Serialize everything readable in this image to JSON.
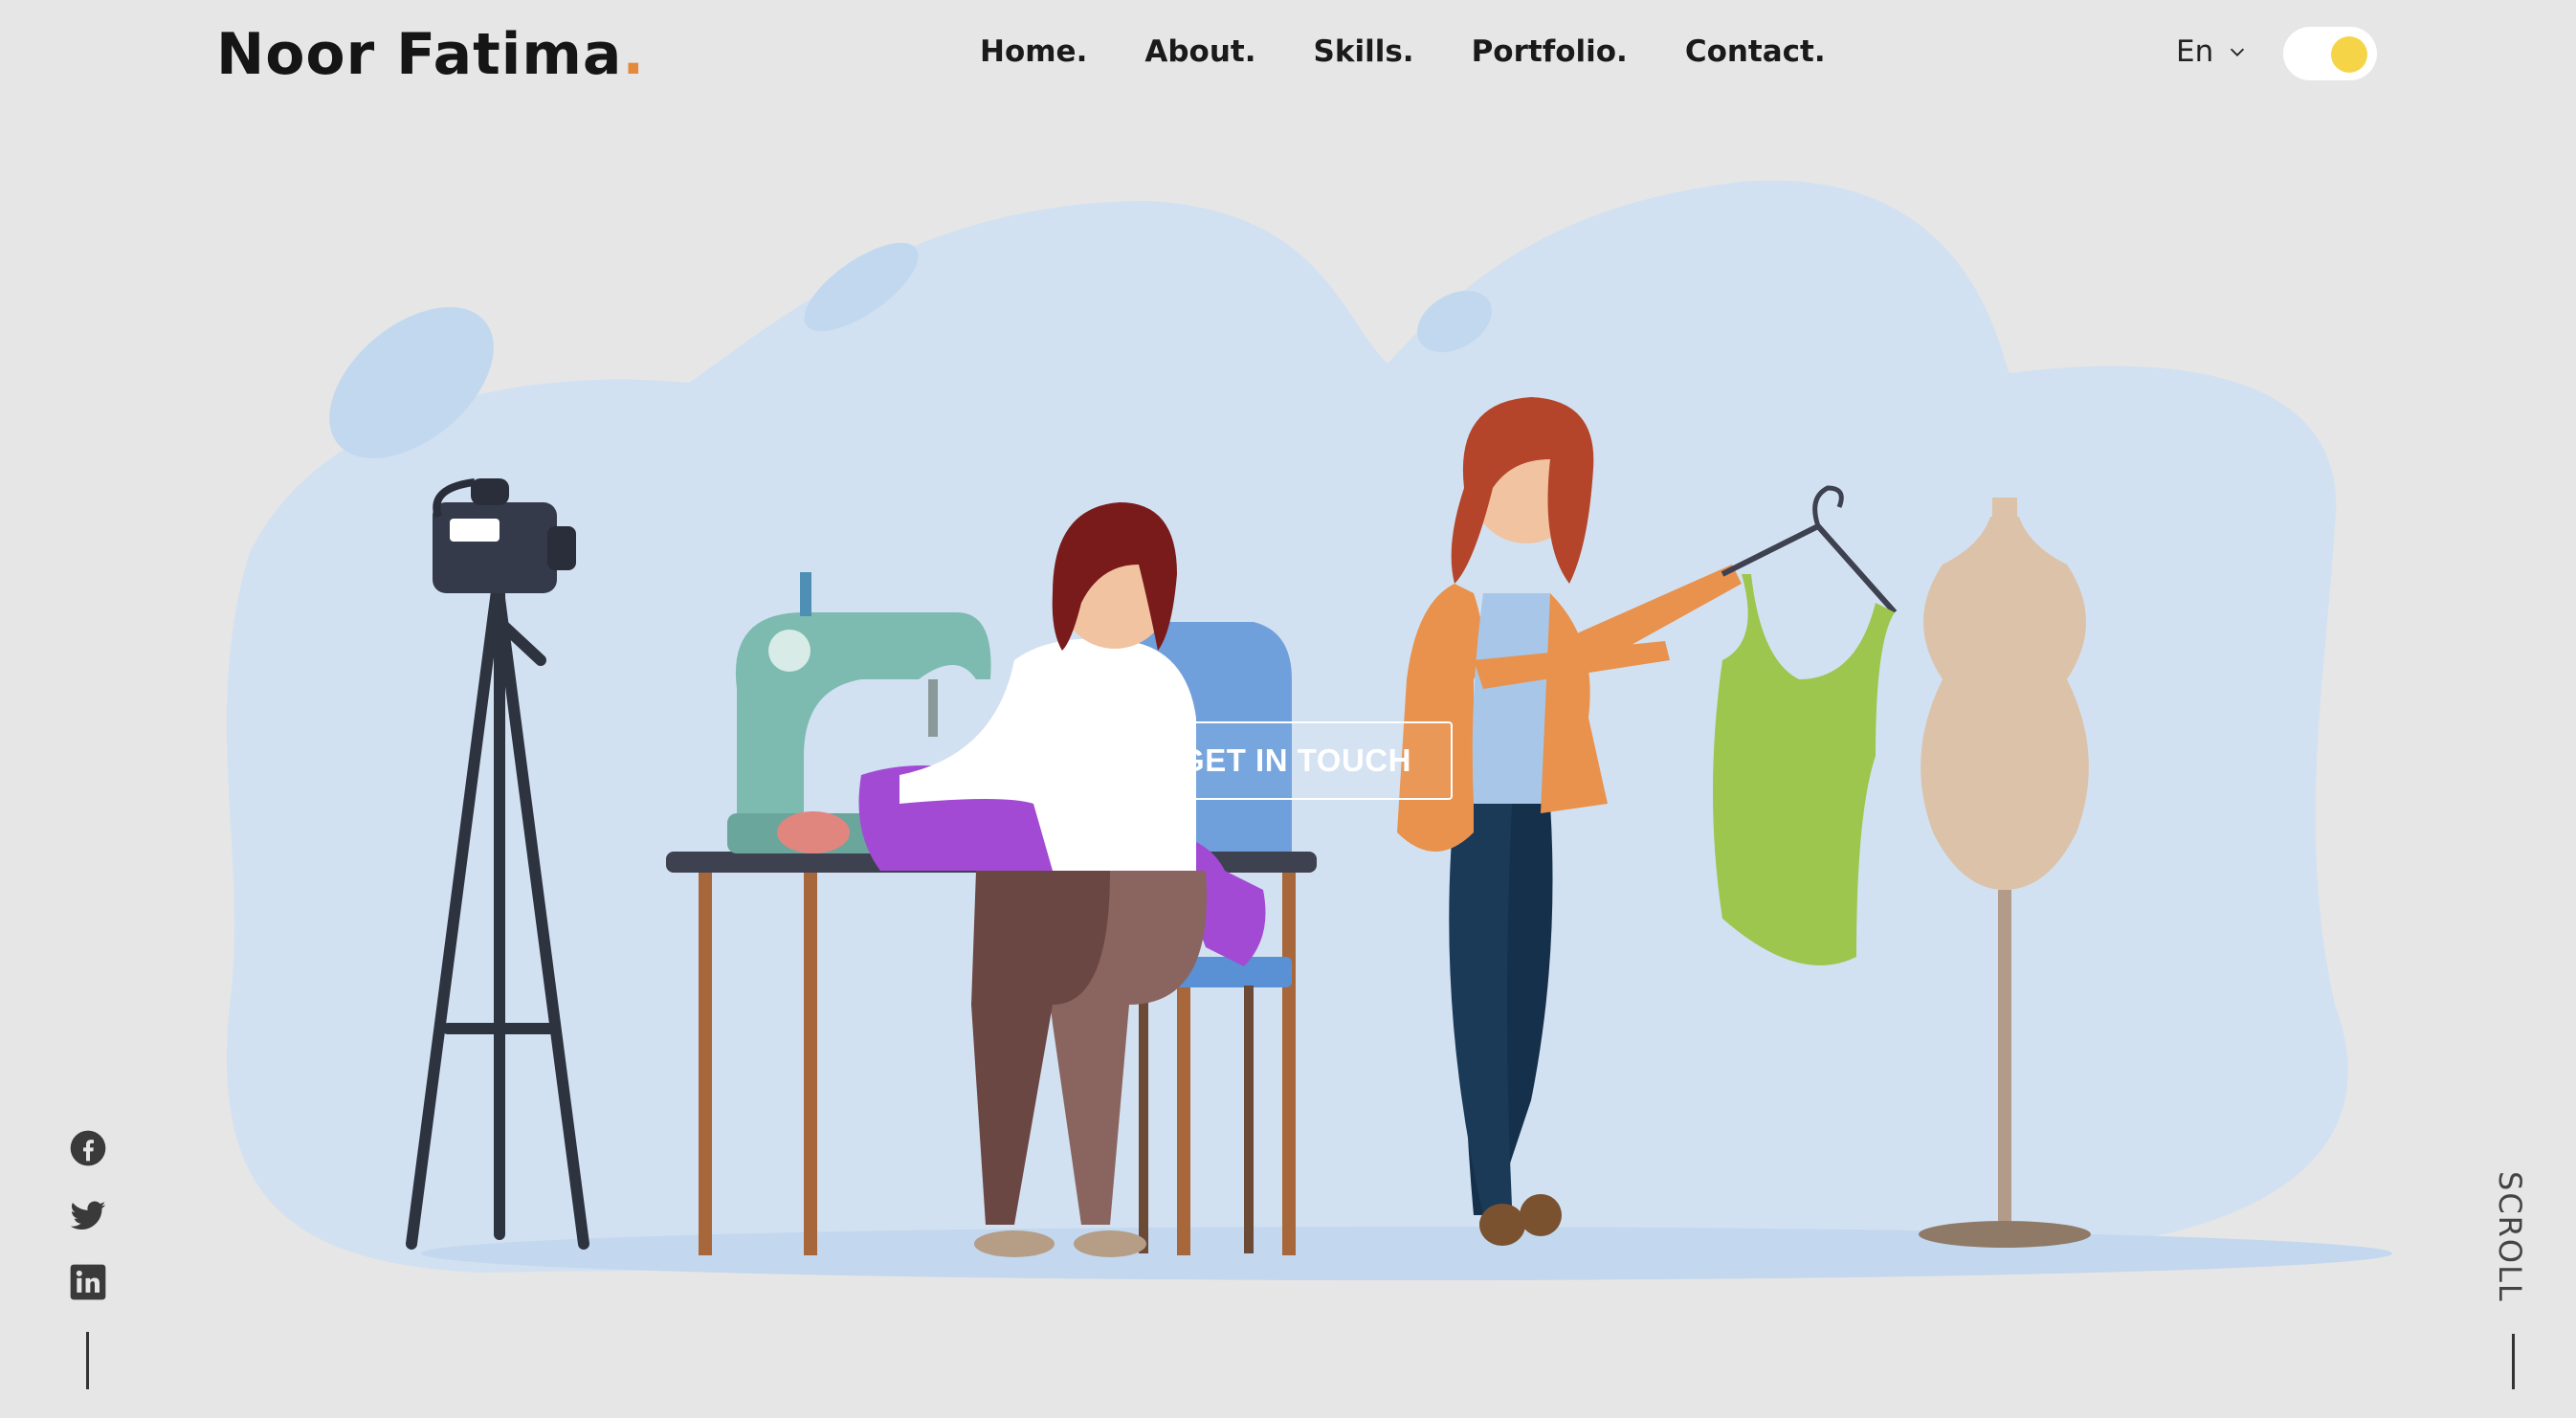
{
  "header": {
    "logo_text": "Noor Fatima",
    "logo_dot": ".",
    "nav": [
      {
        "label": "Home."
      },
      {
        "label": "About."
      },
      {
        "label": "Skills."
      },
      {
        "label": "Portfolio."
      },
      {
        "label": "Contact."
      }
    ],
    "language": "En",
    "theme_toggle_on": true
  },
  "hero": {
    "cta_label": "GET IN TOUCH",
    "illustration": "tailor-studio-illustration"
  },
  "social": [
    {
      "icon": "facebook-icon"
    },
    {
      "icon": "twitter-icon"
    },
    {
      "icon": "linkedin-icon"
    }
  ],
  "scroll_label": "SCROLL",
  "colors": {
    "background": "#e6e6e6",
    "accent": "#e58a3c",
    "toggle_knob": "#f5d547",
    "blob": "#d2e1f1"
  }
}
